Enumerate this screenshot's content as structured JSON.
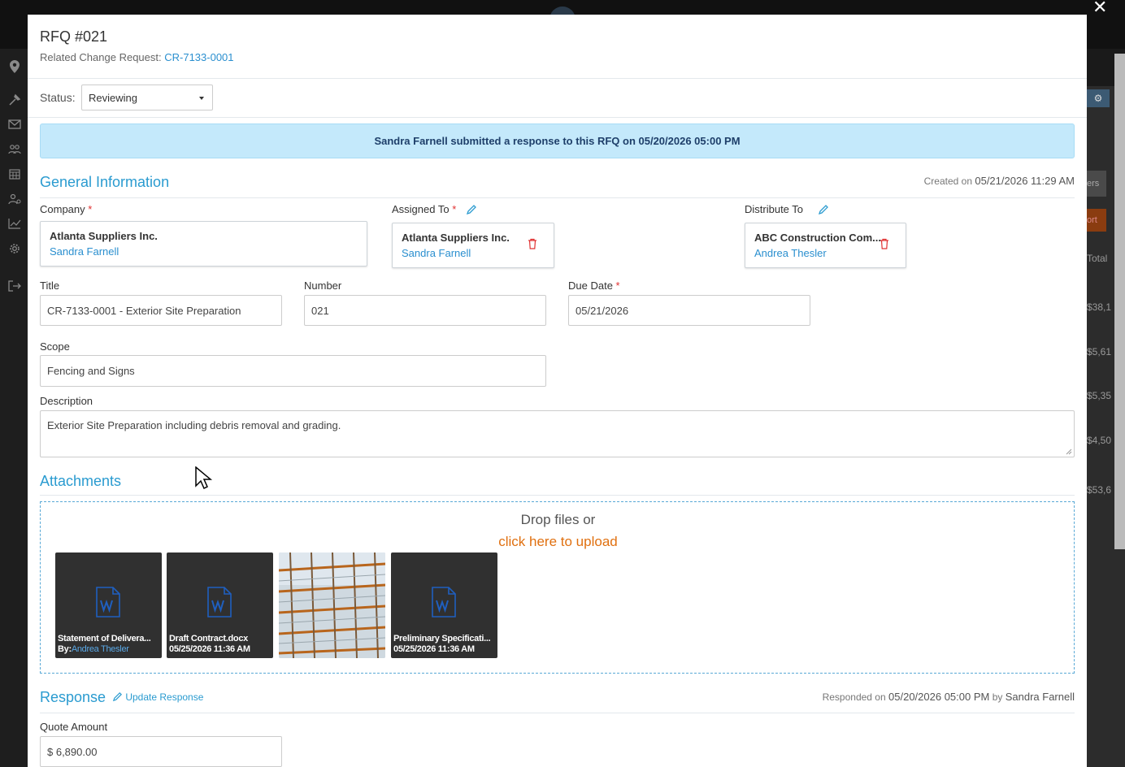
{
  "modal": {
    "title": "RFQ #021",
    "related_label": "Related Change Request:",
    "related_link": "CR-7133-0001",
    "status_label": "Status:",
    "status_value": "Reviewing",
    "banner": "Sandra Farnell submitted a response to this RFQ on 05/20/2026 05:00 PM"
  },
  "general": {
    "section_title": "General Information",
    "created_prefix": "Created on",
    "created_value": "05/21/2026 11:29 AM",
    "company_label": "Company",
    "company_name": "Atlanta Suppliers Inc.",
    "company_person": "Sandra Farnell",
    "assigned_label": "Assigned To",
    "assigned_name": "Atlanta Suppliers Inc.",
    "assigned_person": "Sandra Farnell",
    "distribute_label": "Distribute To",
    "distribute_name": "ABC Construction Com...",
    "distribute_person": "Andrea Thesler",
    "title_label": "Title",
    "title_value": "CR-7133-0001 - Exterior Site Preparation",
    "number_label": "Number",
    "number_value": "021",
    "due_label": "Due Date",
    "due_value": "05/21/2026",
    "scope_label": "Scope",
    "scope_value": "Fencing and Signs",
    "description_label": "Description",
    "description_value": "Exterior Site Preparation including debris removal and grading."
  },
  "attachments": {
    "section_title": "Attachments",
    "drop_text": "Drop files or",
    "upload_link": "click here to upload",
    "files": [
      {
        "name": "Statement of Delivera...",
        "by_prefix": "By:",
        "by": "Andrea Thesler"
      },
      {
        "name": "Draft Contract.docx",
        "date": "05/25/2026 11:36 AM"
      },
      {
        "name": "Preliminary Specificati...",
        "date": "05/25/2026 11:36 AM"
      }
    ]
  },
  "response": {
    "section_title": "Response",
    "update_link": "Update Response",
    "responded_prefix": "Responded on",
    "responded_date": "05/20/2026 05:00 PM",
    "responded_by_prefix": "by",
    "responded_by": "Sandra Farnell",
    "quote_label": "Quote Amount",
    "quote_value": "$ 6,890.00"
  },
  "background": {
    "right_texts": [
      "ers",
      "ort",
      "Total",
      "$38,1",
      "$5,61",
      "$5,35",
      "$4,50",
      "$53,6"
    ]
  },
  "colors": {
    "accent": "#2a9bd0",
    "link": "#2a8fcf",
    "upload": "#e07010",
    "banner_bg": "#c4e9fb",
    "required": "#e03030"
  },
  "icons": [
    "close-icon",
    "pencil-icon",
    "trash-icon",
    "word-doc-icon",
    "caret-down-icon",
    "gear-icon",
    "mouse-cursor-icon"
  ]
}
